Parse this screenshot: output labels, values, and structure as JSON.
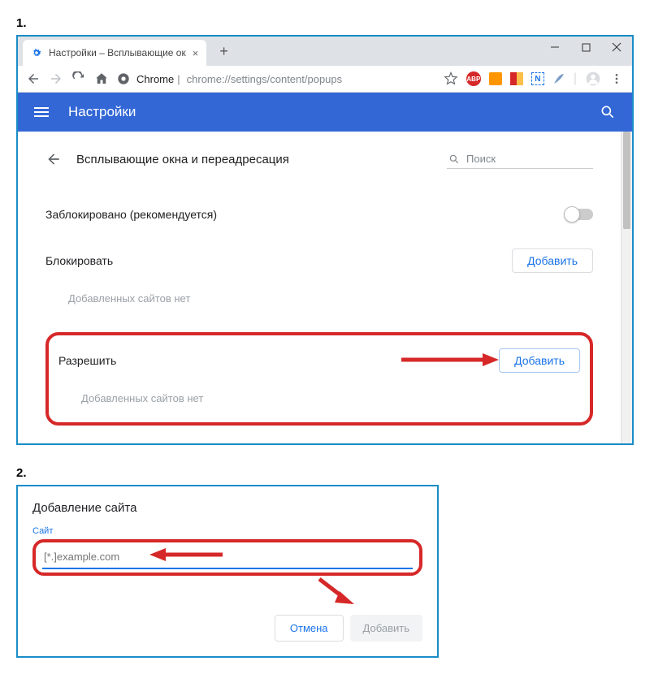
{
  "step1_label": "1.",
  "step2_label": "2.",
  "window": {
    "tab_title": "Настройки – Всплывающие ок",
    "url_prefix": "Chrome",
    "url_path": "chrome://settings/content/popups"
  },
  "header": {
    "title": "Настройки"
  },
  "content": {
    "section_title": "Всплывающие окна и переадресация",
    "search_placeholder": "Поиск",
    "blocked_label": "Заблокировано (рекомендуется)",
    "block_section": "Блокировать",
    "allow_section": "Разрешить",
    "add_button": "Добавить",
    "empty_text": "Добавленных сайтов нет"
  },
  "dialog": {
    "title": "Добавление сайта",
    "field_label": "Сайт",
    "placeholder": "[*.]example.com",
    "cancel": "Отмена",
    "add": "Добавить"
  }
}
